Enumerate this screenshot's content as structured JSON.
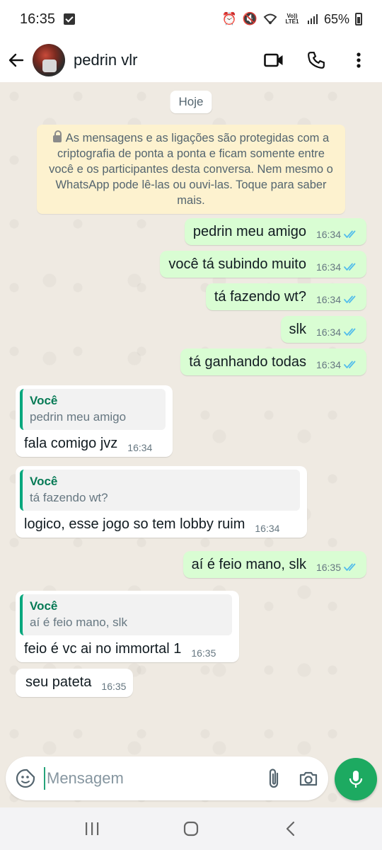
{
  "status_bar": {
    "time": "16:35",
    "battery": "65%",
    "network": "Vo)) LTE1"
  },
  "header": {
    "contact_name": "pedrin vlr",
    "icons": [
      "back-arrow-icon",
      "video-call-icon",
      "phone-icon",
      "more-vert-icon"
    ]
  },
  "chat": {
    "date_label": "Hoje",
    "encryption_notice": "As mensagens e as ligações são protegidas com a criptografia de ponta a ponta e ficam somente entre você e os participantes desta conversa. Nem mesmo o WhatsApp pode lê-las ou ouvi-las. Toque para saber mais.",
    "messages": [
      {
        "direction": "out",
        "text": "pedrin meu amigo",
        "time": "16:34",
        "status": "read"
      },
      {
        "direction": "out",
        "text": "você tá subindo muito",
        "time": "16:34",
        "status": "read"
      },
      {
        "direction": "out",
        "text": "tá fazendo wt?",
        "time": "16:34",
        "status": "read"
      },
      {
        "direction": "out",
        "text": "slk",
        "time": "16:34",
        "status": "read"
      },
      {
        "direction": "out",
        "text": "tá ganhando todas",
        "time": "16:34",
        "status": "read"
      },
      {
        "direction": "in",
        "quote_author": "Você",
        "quote_text": "pedrin meu amigo",
        "text": "fala comigo jvz",
        "time": "16:34"
      },
      {
        "direction": "in",
        "quote_author": "Você",
        "quote_text": "tá fazendo wt?",
        "text": "logico, esse jogo so tem lobby ruim",
        "time": "16:34"
      },
      {
        "direction": "out",
        "text": "aí é feio mano, slk",
        "time": "16:35",
        "status": "read"
      },
      {
        "direction": "in",
        "quote_author": "Você",
        "quote_text": "aí é feio mano, slk",
        "text": "feio é vc ai no immortal 1",
        "time": "16:35"
      },
      {
        "direction": "in",
        "text": "seu pateta",
        "time": "16:35"
      }
    ]
  },
  "input": {
    "placeholder": "Mensagem",
    "value": ""
  },
  "colors": {
    "outgoing_bubble": "#d9fdd3",
    "incoming_bubble": "#ffffff",
    "chat_background": "#efeae2",
    "accent": "#1daa61",
    "read_ticks": "#53bdeb",
    "quote_author": "#067a55"
  }
}
